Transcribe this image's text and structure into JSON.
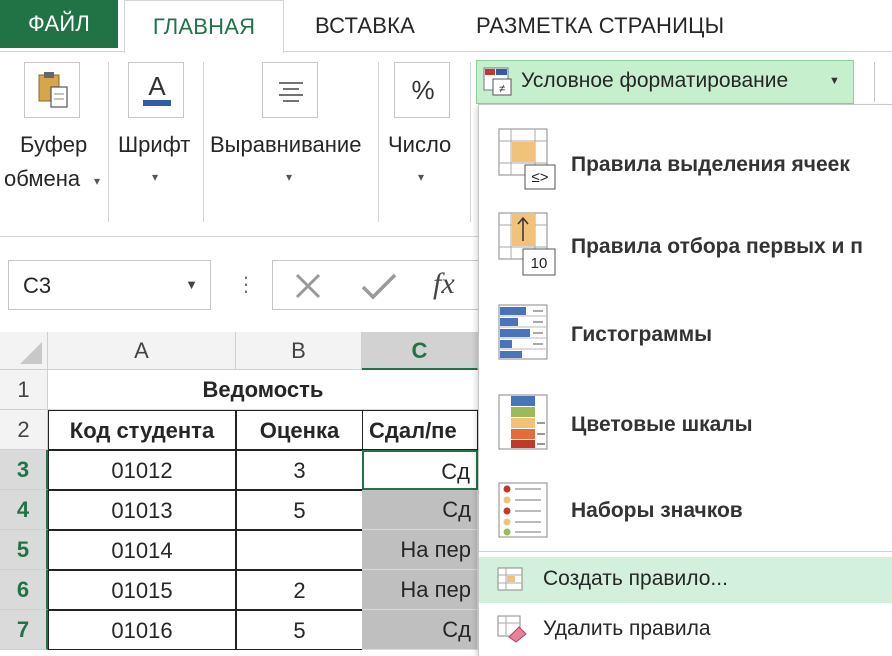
{
  "ribbon_tabs": {
    "file": "ФАЙЛ",
    "home": "ГЛАВНАЯ",
    "insert": "ВСТАВКА",
    "page_layout": "РАЗМЕТКА СТРАНИЦЫ"
  },
  "ribbon_groups": {
    "clipboard": {
      "line1": "Буфер",
      "line2": "обмена",
      "icon": "clipboard-icon"
    },
    "font": {
      "label": "Шрифт",
      "icon_glyph": "A"
    },
    "alignment": {
      "label": "Выравнивание",
      "icon": "align-icon"
    },
    "number": {
      "label": "Число",
      "icon_glyph": "%"
    }
  },
  "conditional_formatting": {
    "label": "Условное форматирование",
    "items": [
      {
        "label": "Правила выделения ячеек",
        "icon": "highlight-cells-rules-icon"
      },
      {
        "label": "Правила отбора первых и п",
        "icon": "top-bottom-rules-icon",
        "badge": "10"
      },
      {
        "label": "Гистограммы",
        "icon": "data-bars-icon"
      },
      {
        "label": "Цветовые шкалы",
        "icon": "color-scales-icon"
      },
      {
        "label": "Наборы значков",
        "icon": "icon-sets-icon"
      }
    ],
    "create_rule": "Создать правило...",
    "clear_rules": "Удалить правила"
  },
  "formula_bar": {
    "name_box": "C3",
    "fx": "fx"
  },
  "grid": {
    "columns": [
      "A",
      "B",
      "C"
    ],
    "rows": [
      "1",
      "2",
      "3",
      "4",
      "5",
      "6",
      "7"
    ],
    "title": "Ведомость",
    "headers": [
      "Код студента",
      "Оценка",
      "Сдал/пе"
    ],
    "data": [
      [
        "01012",
        "3",
        "Сд"
      ],
      [
        "01013",
        "5",
        "Сд"
      ],
      [
        "01014",
        "",
        "На пер"
      ],
      [
        "01015",
        "2",
        "На пер"
      ],
      [
        "01016",
        "5",
        "Сд"
      ]
    ]
  },
  "colors": {
    "excel_green": "#217346",
    "menu_highlight": "#d3f0dc",
    "cf_button": "#c6efce"
  }
}
